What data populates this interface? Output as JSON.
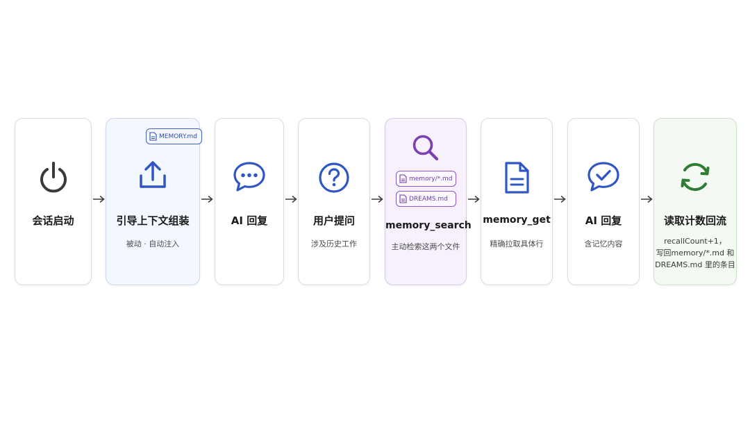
{
  "steps": [
    {
      "title": "会话启动",
      "subtitle": "",
      "icon": "power-icon"
    },
    {
      "title": "引导上下文组装",
      "subtitle": "被动 · 自动注入",
      "icon": "upload-icon",
      "badge": "MEMORY.md"
    },
    {
      "title": "AI 回复",
      "subtitle": "",
      "icon": "chat-bubble-dots-icon"
    },
    {
      "title": "用户提问",
      "subtitle": "涉及历史工作",
      "icon": "question-circle-icon"
    },
    {
      "title": "memory_search",
      "subtitle": "主动检索这两个文件",
      "icon": "search-icon",
      "badges": [
        "memory/*.md",
        "DREAMS.md"
      ]
    },
    {
      "title": "memory_get",
      "subtitle": "精确拉取具体行",
      "icon": "document-icon"
    },
    {
      "title": "AI 回复",
      "subtitle": "含记忆内容",
      "icon": "chat-bubble-check-icon"
    },
    {
      "title": "读取计数回流",
      "description_lines": [
        "recallCount+1，",
        "写回memory/*.md 和",
        "DREAMS.md 里的条目"
      ],
      "icon": "refresh-icon"
    }
  ],
  "colors": {
    "dark": "#3a3a3a",
    "blue": "#2f56c4",
    "purple": "#7b3fb3",
    "green": "#2e7d32"
  }
}
